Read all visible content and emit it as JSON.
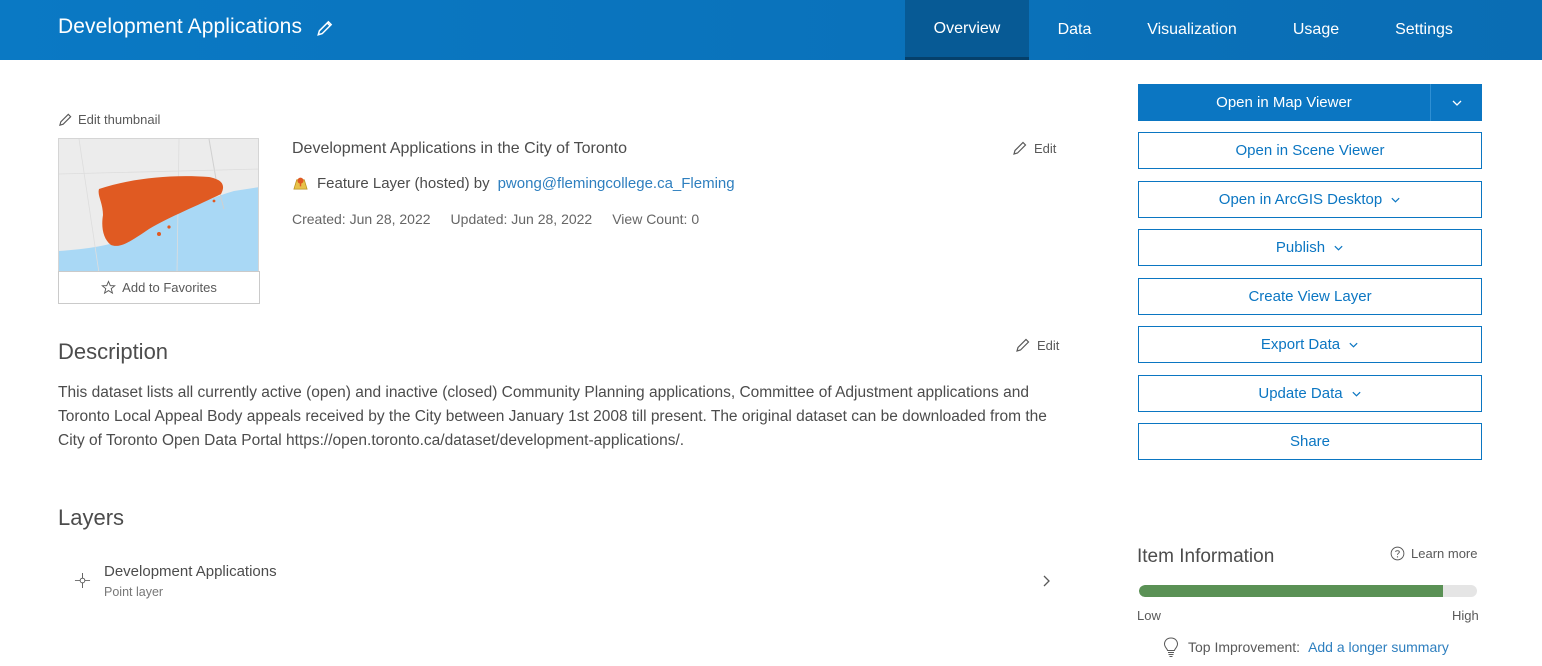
{
  "header": {
    "title": "Development Applications",
    "tabs": [
      {
        "label": "Overview",
        "active": true
      },
      {
        "label": "Data",
        "active": false
      },
      {
        "label": "Visualization",
        "active": false
      },
      {
        "label": "Usage",
        "active": false
      },
      {
        "label": "Settings",
        "active": false
      }
    ]
  },
  "thumbnail": {
    "edit_label": "Edit thumbnail",
    "favorites_label": "Add to Favorites"
  },
  "summary": {
    "text": "Development Applications in the City of Toronto",
    "edit_label": "Edit",
    "type_text": "Feature Layer (hosted) by",
    "owner": "pwong@flemingcollege.ca_Fleming",
    "created": "Created: Jun 28, 2022",
    "updated": "Updated: Jun 28, 2022",
    "views": "View Count: 0"
  },
  "description": {
    "title": "Description",
    "edit_label": "Edit",
    "text": "This dataset lists all currently active (open) and inactive (closed) Community Planning applications, Committee of Adjustment applications and Toronto Local Appeal Body appeals received by the City between January 1st 2008 till present. The original dataset can be downloaded from the City of Toronto Open Data Portal https://open.toronto.ca/dataset/development-applications/."
  },
  "layers": {
    "title": "Layers",
    "items": [
      {
        "name": "Development Applications",
        "type": "Point layer"
      }
    ]
  },
  "actions": {
    "map_viewer": "Open in Map Viewer",
    "scene_viewer": "Open in Scene Viewer",
    "arcgis_desktop": "Open in ArcGIS Desktop",
    "publish": "Publish",
    "create_view": "Create View Layer",
    "export": "Export Data",
    "update": "Update Data",
    "share": "Share"
  },
  "item_info": {
    "title": "Item Information",
    "learn_more": "Learn more",
    "score_fraction": 0.9,
    "low_label": "Low",
    "high_label": "High",
    "top_improvement_label": "Top Improvement:",
    "top_improvement_link": "Add a longer summary"
  },
  "colors": {
    "header": "#0a79c4",
    "accent": "#0b76c2",
    "meter_fill": "#5a9155",
    "thumbnail_points": "#e05a22"
  }
}
